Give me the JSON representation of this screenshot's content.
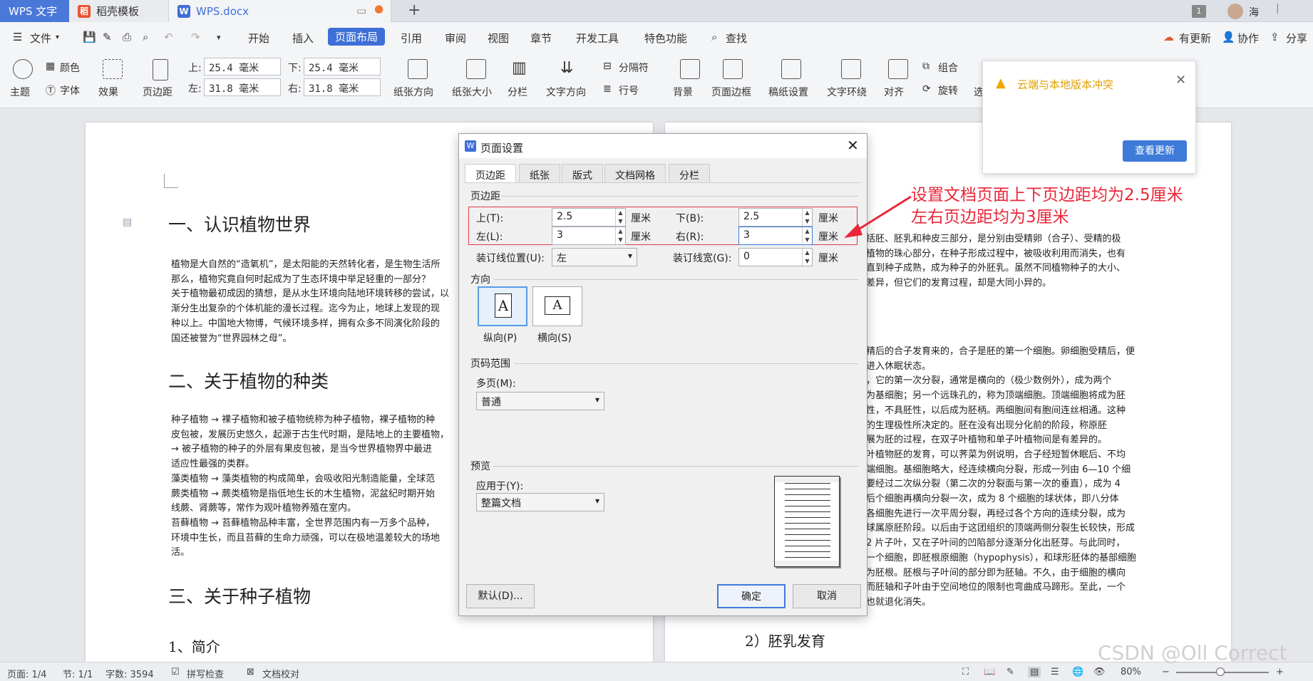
{
  "tabs": {
    "wps": "WPS 文字",
    "template": "稻壳模板",
    "doc": "WPS.docx"
  },
  "window": {
    "badge": "1",
    "user": "海"
  },
  "menu": {
    "file": "文件",
    "items": [
      "开始",
      "插入",
      "页面布局",
      "引用",
      "审阅",
      "视图",
      "章节",
      "开发工具",
      "特色功能"
    ],
    "active": "页面布局",
    "search": "查找",
    "update": "有更新",
    "collab": "协作",
    "share": "分享"
  },
  "ribbon": {
    "theme": "主题",
    "color": "颜色",
    "font": "字体",
    "effect": "效果",
    "margin": "页边距",
    "top_l": "上:",
    "top_v": "25.4 毫米",
    "bottom_l": "下:",
    "bottom_v": "25.4 毫米",
    "left_l": "左:",
    "left_v": "31.8 毫米",
    "right_l": "右:",
    "right_v": "31.8 毫米",
    "orientation": "纸张方向",
    "size": "纸张大小",
    "columns": "分栏",
    "textdir": "文字方向",
    "separator": "分隔符",
    "linenum": "行号",
    "bg": "背景",
    "border": "页面边框",
    "grid": "稿纸设置",
    "wrap": "文字环绕",
    "align": "对齐",
    "group": "组合",
    "rotate": "旋转",
    "more": "选"
  },
  "notice": {
    "title": "云端与本地版本冲突",
    "button": "查看更新"
  },
  "doc_left": {
    "h1": "一、认识植物世界",
    "p1": "植物是大自然的“造氧机”，是太阳能的天然转化者，是生物生活所\n那么，植物究竟自何时起成为了生态环境中举足轻重的一部分？\n关于植物最初成因的猜想，是从水生环境向陆地环境转移的尝试，以\n渐分生出复杂的个体机能的漫长过程。迄今为止，地球上发现的现\n种以上。中国地大物博，气候环境多样，拥有众多不同演化阶段的\n国还被誉为“世界园林之母”。",
    "h2": "二、关于植物的种类",
    "p2": "种子植物 → 裸子植物和被子植物统称为种子植物，裸子植物的种\n皮包被，发展历史悠久，起源于古生代时期，是陆地上的主要植物，\n→ 被子植物的种子的外层有果皮包被，是当今世界植物界中最进\n适应性最强的类群。\n藻类植物 → 藻类植物的构成简单，会吸收阳光制造能量，全球范\n蕨类植物 → 蕨类植物是指低地生长的木生植物，泥盆纪时期开始\n线蕨、肾蕨等，常作为观叶植物养殖在室内。\n苔藓植物 → 苔藓植物品种丰富，全世界范围内有一万多个品种，\n环境中生长，而且苔藓的生命力顽强，可以在极地温差较大的场地\n活。",
    "h3": "三、关于种子植物",
    "h4": "1、简介"
  },
  "doc_right": {
    "p1": "括胚、胚乳和种皮三部分，是分别由受精卵（合子）、受精的极\n植物的珠心部分，在种子形成过程中，被吸收利用而消失，也有\n直到种子成熟，成为种子的外胚乳。虽然不同植物种子的大小、\n差异，但它们的发育过程，却是大同小异的。",
    "p2": "精后的合子发育来的，合子是胚的第一个细胞。卵细胞受精后，便\n进入休眠状态。\n，它的第一次分裂，通常是横向的（极少数例外），成为两个\n为基细胞；另一个远珠孔的，称为顶端细胞。顶端细胞将成为胚\n性，不具胚性，以后成为胚柄。两细胞间有胞间连丝相通。这种\n的生理极性所决定的。胚在没有出现分化前的阶段，称原胚\n展为胚的过程，在双子叶植物和单子叶植物间是有差异的。\n叶植物胚的发育，可以荠菜为例说明，合子经短暂休眠后、不均\n端细胞。基细胞略大，经连续横向分裂，形成一列由 6—10 个细\n要经过二次纵分裂（第二次的分裂面与第一次的垂直），成为 4\n后个细胞再横向分裂一次，成为 8 个细胞的球状体，即八分体\n各细胞先进行一次平周分裂，再经过各个方向的连续分裂，成为\n球属原胚阶段。以后由于这团组织的顶端两侧分裂生长较快，形成\n2 片子叶，又在子叶间的凹陷部分逐渐分化出胚芽。与此同时，\n一个细胞，即胚根原细胞（hypophysis），和球形胚体的基部细胞\n为胚根。胚根与子叶间的部分即为胚轴。不久，由于细胞的横向\n而胚轴和子叶由于空间地位的限制也弯曲成马蹄形。至此，一个\n也就退化消失。",
    "h5": "2）胚乳发育"
  },
  "dialog": {
    "title": "页面设置",
    "tabs": [
      "页边距",
      "纸张",
      "版式",
      "文档网格",
      "分栏"
    ],
    "margins_group": "页边距",
    "top_label": "上(T):",
    "top_value": "2.5",
    "bottom_label": "下(B):",
    "bottom_value": "2.5",
    "left_label": "左(L):",
    "left_value": "3",
    "right_label": "右(R):",
    "right_value": "3",
    "unit": "厘米",
    "gutter_pos_label": "装订线位置(U):",
    "gutter_pos_value": "左",
    "gutter_label": "装订线宽(G):",
    "gutter_value": "0",
    "orient_group": "方向",
    "portrait": "纵向(P)",
    "landscape": "横向(S)",
    "pages_group": "页码范围",
    "multi_label": "多页(M):",
    "multi_value": "普通",
    "preview_group": "预览",
    "apply_label": "应用于(Y):",
    "apply_value": "整篇文档",
    "default_btn": "默认(D)...",
    "ok_btn": "确定",
    "cancel_btn": "取消"
  },
  "annotation": [
    "设置文档页面上下页边距均为2.5厘米",
    "左右页边距均为3厘米"
  ],
  "status": {
    "page": "页面: 1/4",
    "section": "节: 1/1",
    "words": "字数: 3594",
    "spell": "拼写检查",
    "proof": "文档校对",
    "zoom": "80%",
    "watermark": "CSDN @Oll Correct"
  },
  "colors": {
    "accent": "#3e6fd8",
    "annot": "#e8283a",
    "notice_btn": "#3e7bd9"
  }
}
